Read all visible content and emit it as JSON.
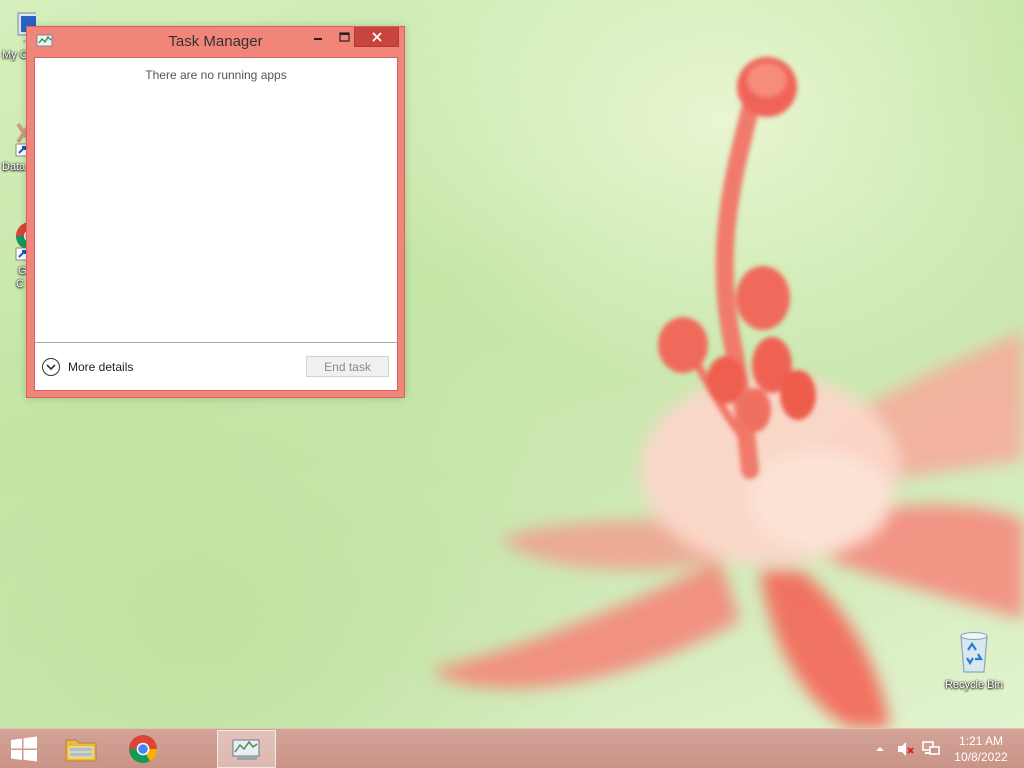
{
  "desktop": {
    "icons": [
      {
        "label": "My C"
      },
      {
        "label": "Data"
      },
      {
        "label_line1": "G",
        "label_line2": "C"
      },
      {
        "label": "Recycle Bin"
      }
    ]
  },
  "task_manager": {
    "title": "Task Manager",
    "empty_message": "There are no running apps",
    "more_details_label": "More details",
    "end_task_label": "End task",
    "accent_color": "#f2857a",
    "close_color": "#c7453c"
  },
  "taskbar": {
    "pinned": [
      "windows-start",
      "file-explorer",
      "google-chrome",
      "task-manager"
    ],
    "clock": {
      "time": "1:21 AM",
      "date": "10/8/2022"
    }
  }
}
